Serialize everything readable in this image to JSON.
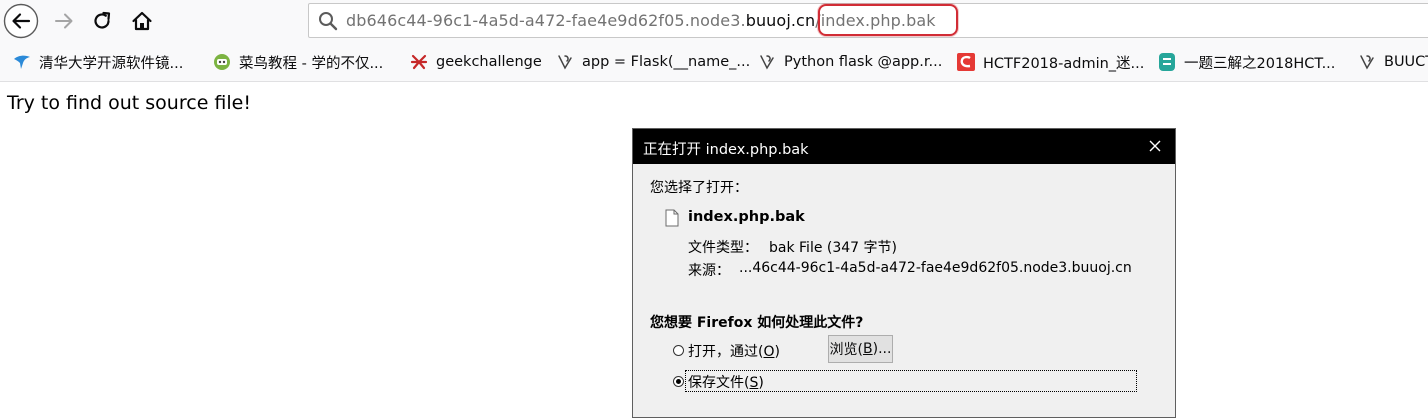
{
  "toolbar": {
    "back_icon": "back-arrow-icon",
    "forward_icon": "forward-arrow-icon",
    "reload_icon": "reload-icon",
    "home_icon": "home-icon",
    "url_prefix": "db646c44-96c1-4a5d-a472-fae4e9d62f05.node3.",
    "url_host": "buuoj.c",
    "url_host_tail": "n",
    "url_path": "/index.php.bak",
    "highlight_color": "#d12c35"
  },
  "bookmarks": [
    {
      "label": "清华大学开源软件镜...",
      "icon": "tuna-bird-icon"
    },
    {
      "label": "菜鸟教程 - 学的不仅...",
      "icon": "runoob-icon"
    },
    {
      "label": "geekchallenge",
      "icon": "geek-icon"
    },
    {
      "label": "app = Flask(__name_...",
      "icon": "page-icon"
    },
    {
      "label": "Python flask @app.r...",
      "icon": "page-icon"
    },
    {
      "label": "HCTF2018-admin_迷...",
      "icon": "csdn-icon"
    },
    {
      "label": "一题三解之2018HCT...",
      "icon": "green-doc-icon"
    },
    {
      "label": "BUUCT",
      "icon": "page-icon"
    }
  ],
  "page": {
    "message": "Try to find out source file!"
  },
  "dialog": {
    "title": "正在打开 index.php.bak",
    "you_chose": "您选择了打开：",
    "file_name": "index.php.bak",
    "type_label": "文件类型：",
    "type_value": "bak File (347 字节)",
    "source_label": "来源：",
    "source_value": "...46c44-96c1-4a5d-a472-fae4e9d62f05.node3.buuoj.cn",
    "question": "您想要 Firefox 如何处理此文件?",
    "open_with_label": "打开，通过(",
    "open_with_key": "O",
    "browse_label": "浏览(",
    "browse_key": "B",
    "browse_suffix": ")...",
    "save_label": "保存文件(",
    "save_key": "S",
    "selected_option": "save"
  }
}
